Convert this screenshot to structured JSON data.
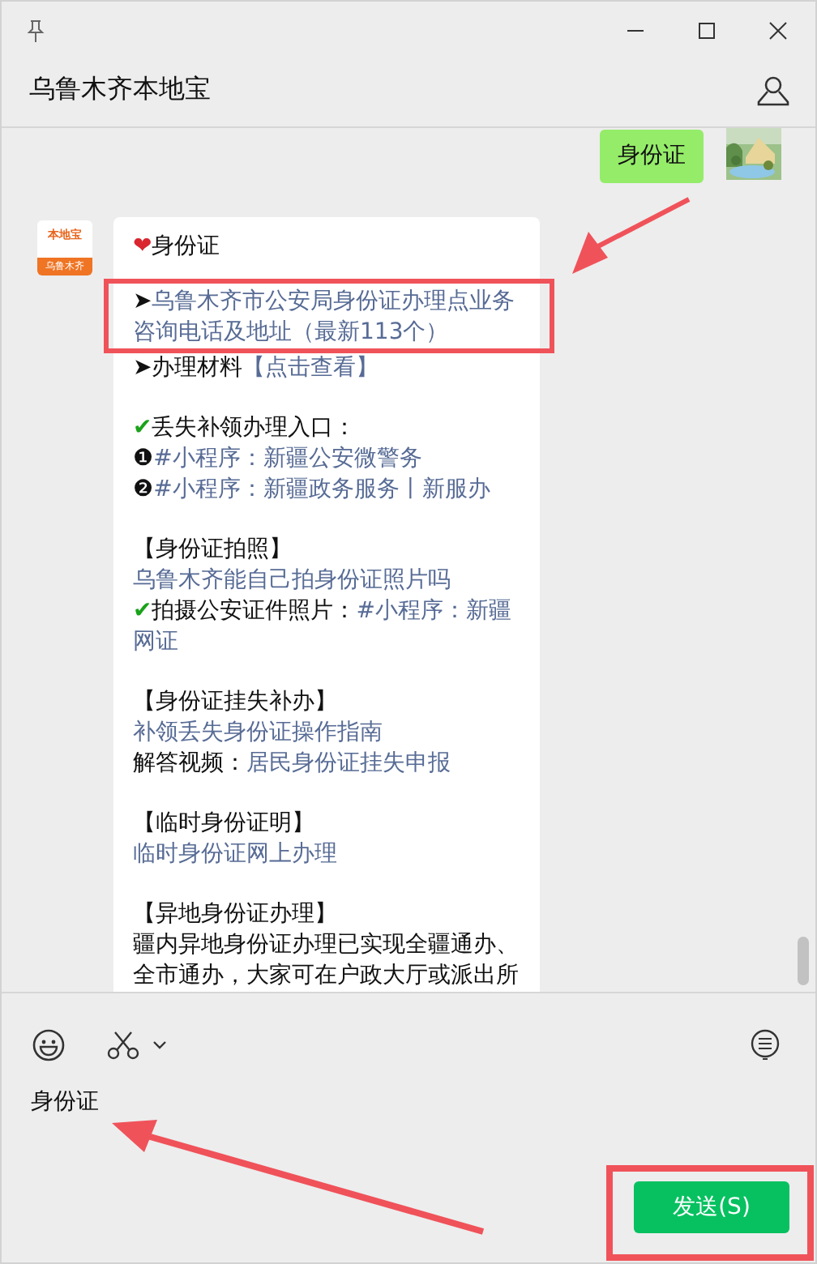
{
  "window": {
    "title": "乌鲁木齐本地宝"
  },
  "messages": [
    {
      "kind": "sent",
      "text": "身份证"
    },
    {
      "kind": "received",
      "avatar": {
        "brand": "本地宝",
        "city": "乌鲁木齐"
      },
      "blocks": [
        [
          {
            "segments": [
              {
                "kind": "heart",
                "text": "❤"
              },
              {
                "kind": "plain",
                "text": "身份证"
              }
            ]
          }
        ],
        [
          {
            "segments": [
              {
                "kind": "plain",
                "text": "➤"
              },
              {
                "kind": "link",
                "text": "乌鲁木齐市公安局身份证办理点业务咨询电话及地址（最新113个）"
              }
            ]
          },
          {
            "segments": [
              {
                "kind": "plain",
                "text": "➤办理材料"
              },
              {
                "kind": "link",
                "text": "【点击查看】"
              }
            ]
          }
        ],
        [
          {
            "segments": [
              {
                "kind": "check",
                "text": "✔"
              },
              {
                "kind": "plain",
                "text": "丢失补领办理入口："
              }
            ]
          },
          {
            "segments": [
              {
                "kind": "plain",
                "text": "❶"
              },
              {
                "kind": "link",
                "text": "#小程序：新疆公安微警务"
              }
            ]
          },
          {
            "segments": [
              {
                "kind": "plain",
                "text": "❷"
              },
              {
                "kind": "link",
                "text": "#小程序：新疆政务服务丨新服办"
              }
            ]
          }
        ],
        [
          {
            "segments": [
              {
                "kind": "plain",
                "text": "【身份证拍照】"
              }
            ]
          },
          {
            "segments": [
              {
                "kind": "link",
                "text": "乌鲁木齐能自己拍身份证照片吗"
              }
            ]
          },
          {
            "segments": [
              {
                "kind": "check",
                "text": "✔"
              },
              {
                "kind": "plain",
                "text": "拍摄公安证件照片："
              },
              {
                "kind": "link",
                "text": "#小程序：新疆网证"
              }
            ]
          }
        ],
        [
          {
            "segments": [
              {
                "kind": "plain",
                "text": "【身份证挂失补办】"
              }
            ]
          },
          {
            "segments": [
              {
                "kind": "link",
                "text": "补领丢失身份证操作指南"
              }
            ]
          },
          {
            "segments": [
              {
                "kind": "plain",
                "text": "解答视频："
              },
              {
                "kind": "link",
                "text": "居民身份证挂失申报"
              }
            ]
          }
        ],
        [
          {
            "segments": [
              {
                "kind": "plain",
                "text": "【临时身份证明】"
              }
            ]
          },
          {
            "segments": [
              {
                "kind": "link",
                "text": "临时身份证网上办理"
              }
            ]
          }
        ],
        [
          {
            "segments": [
              {
                "kind": "plain",
                "text": "【异地身份证办理】"
              }
            ]
          },
          {
            "segments": [
              {
                "kind": "plain",
                "text": "疆内异地身份证办理已实现全疆通办、全市通办，大家可在户政大厅或派出所"
              }
            ]
          }
        ]
      ]
    }
  ],
  "composer": {
    "value": "身份证",
    "send_label": "发送(S)"
  }
}
